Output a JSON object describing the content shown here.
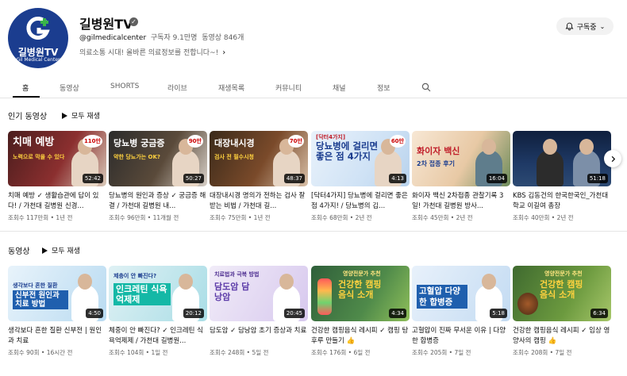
{
  "channel": {
    "avatar_title": "길병원TV",
    "avatar_sub": "Gil Medical Center",
    "name": "길병원TV",
    "handle": "@gilmedicalcenter",
    "subscribers": "구독자 9.1만명",
    "video_count": "동영상 846개",
    "description": "의료소통 시대! 올바른 의료정보를 전합니다~!",
    "subscribe_label": "구독중",
    "brand_color": "#1b3d8f"
  },
  "tabs": [
    "홈",
    "동영상",
    "SHORTS",
    "라이브",
    "재생목록",
    "커뮤니티",
    "채널",
    "정보"
  ],
  "popular": {
    "title": "인기 동영상",
    "play_all": "모두 재생",
    "videos": [
      {
        "thumb_main": "치매 예방",
        "thumb_sub": "노력으로 막을 수 있다",
        "badge": "110만",
        "duration": "52:42",
        "title": "치매 예방 ✓ 생활습관에 답이 있다! / 가천대 길병원 신경...",
        "meta": "조회수 117만회 • 1년 전"
      },
      {
        "thumb_main": "당뇨병 궁금증",
        "thumb_sub": "약한 당뇨가는 OK?",
        "badge": "90만",
        "duration": "50:27",
        "title": "당뇨병의 원인과 증상 ✓ 궁금증 해결 / 가천대 길병원 내...",
        "meta": "조회수 96만회 • 11개월 전"
      },
      {
        "thumb_main": "대장내시경",
        "thumb_sub": "검사 전 필수시청",
        "badge": "70만",
        "duration": "48:37",
        "title": "대장내시경 명의가 전하는 검사 잘 받는 비법 / 가천대 길...",
        "meta": "조회수 75만회 • 1년 전"
      },
      {
        "thumb_main": "당뇨병에 걸리면 좋은 점 4가지",
        "thumb_sub": "[닥터4가지]",
        "badge": "60만",
        "duration": "4:13",
        "title": "[닥터4가지] 당뇨병에 걸리면 좋은 점 4가지! / 당뇨병의 김...",
        "meta": "조회수 68만회 • 2년 전"
      },
      {
        "thumb_main": "화이자 백신",
        "thumb_sub": "2차 접종 후기",
        "badge": "",
        "duration": "16:04",
        "title": "화이자 백신 2차접종 관찰기록 3일! 가천대 길병원 방사...",
        "meta": "조회수 45만회 • 2년 전"
      },
      {
        "thumb_main": "",
        "thumb_sub": "",
        "badge": "",
        "duration": "51:18",
        "title": "KBS 김동건의 한국한국인_가천대학교 이길여 총장",
        "meta": "조회수 40만회 • 2년 전"
      }
    ]
  },
  "uploads": {
    "title": "동영상",
    "play_all": "모두 재생",
    "videos": [
      {
        "thumb_main": "신부전 원인과 치료 방법",
        "thumb_sub": "생각보다 흔한 질환",
        "badge": "",
        "duration": "4:50",
        "title": "생각보다 흔한 질환 신부전 | 원인과 치료",
        "meta": "조회수 90회 • 16시간 전"
      },
      {
        "thumb_main": "인크레틴 식욕억제제",
        "thumb_sub": "제충이 안 빠진다?",
        "badge": "",
        "duration": "20:12",
        "title": "체중이 안 빠진다? ✓ 인크레틴 식욕억제제 / 가천대 길병원...",
        "meta": "조회수 104회 • 1일 전"
      },
      {
        "thumb_main": "담도암 담낭암",
        "thumb_sub": "치료법과 극복 방법",
        "badge": "",
        "duration": "20:45",
        "title": "담도암 ✓ 담낭암 초기 증상과 치료",
        "meta": "조회수 248회 • 5일 전"
      },
      {
        "thumb_main": "건강한 캠핑음식 소개",
        "thumb_sub": "영양전문가 추천",
        "badge": "",
        "duration": "4:34",
        "title": "건강한 캠핑음식 레시피 ✓ 캠핑 탕후루 만들기 👍",
        "meta": "조회수 176회 • 6일 전"
      },
      {
        "thumb_main": "고혈압 다양한 합병증",
        "thumb_sub": "",
        "badge": "",
        "duration": "5:18",
        "title": "고혈압이 진짜 무서운 이유 | 다양한 합병증",
        "meta": "조회수 205회 • 7일 전"
      },
      {
        "thumb_main": "건강한 캠핑음식 소개",
        "thumb_sub": "영양전문가 추천",
        "badge": "",
        "duration": "6:34",
        "title": "건강한 캠핑음식 레시피 ✓ 임상 영양사의 캠핑 👍",
        "meta": "조회수 208회 • 7일 전"
      }
    ]
  }
}
